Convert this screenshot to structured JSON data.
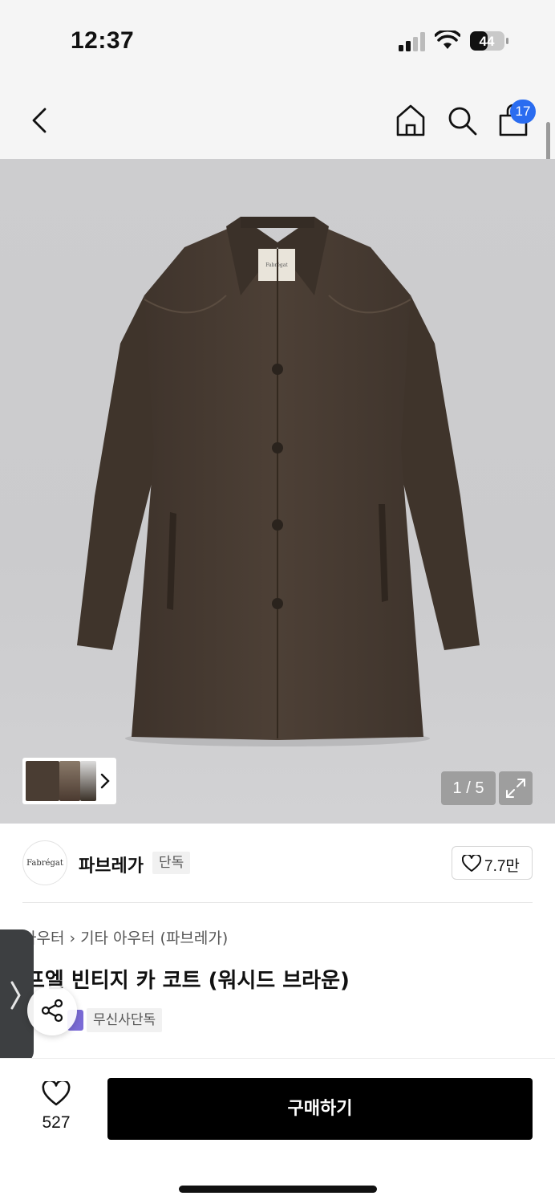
{
  "status_bar": {
    "time": "12:37",
    "battery": "44"
  },
  "nav": {
    "cart_count": "17",
    "icons": [
      "back-icon",
      "home-icon",
      "search-icon",
      "cart-icon"
    ]
  },
  "gallery": {
    "pager": "1 / 5",
    "label_on_garment": "Fabrégat"
  },
  "brand": {
    "logo_text": "Fabrégat",
    "name": "파브레가",
    "tag": "단독",
    "likes": "7.7만"
  },
  "breadcrumb": {
    "first": "아우터",
    "second": "기타 아우터 (파브레가)"
  },
  "product": {
    "title": "프엘 빈티지 카 코트 (워시드 브라운)",
    "exclusive_tag": "무신사단독"
  },
  "bottom_bar": {
    "wish_count": "527",
    "buy_label": "구매하기"
  },
  "colors": {
    "accent_blue": "#2a6cf0",
    "coat_brown": "#4a3d33",
    "buy_button": "#000000"
  }
}
